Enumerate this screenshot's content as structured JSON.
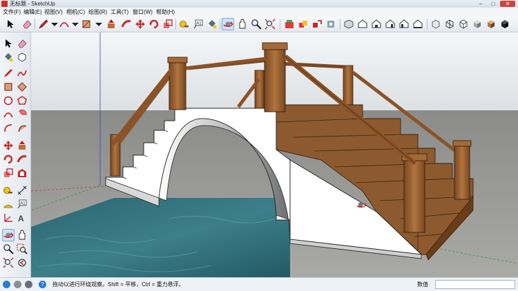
{
  "window": {
    "title": "无标题 - SketchUp",
    "controls": [
      "–",
      "□",
      "✕"
    ]
  },
  "menu": [
    "文件(F)",
    "编辑(E)",
    "视图(V)",
    "相机(C)",
    "绘图(R)",
    "工具(T)",
    "窗口(W)",
    "帮助(H)"
  ],
  "toolbar": {
    "icons": [
      "select-arrow-icon",
      "eraser-icon",
      "pencil-line-icon",
      "dropdown-arrow-icon",
      "arc-icon",
      "dropdown-arrow-icon",
      "rectangle-icon",
      "dropdown-arrow-icon",
      "push-pull-icon",
      "follow-me-icon",
      "move-icon",
      "rotate-icon",
      "tape-measure-icon",
      "text-icon",
      "paint-bucket-icon",
      "orbit-icon",
      "pan-icon",
      "zoom-icon",
      "zoom-extents-icon",
      "warehouse-icon",
      "components-icon",
      "share-icon",
      "extension-icon",
      "iso-view-icon",
      "top-view-icon",
      "front-view-icon",
      "right-view-icon",
      "back-view-icon",
      "left-view-icon",
      "xray-icon",
      "wireframe-icon",
      "hidden-line-icon",
      "shaded-icon",
      "textured-icon",
      "monochrome-icon"
    ],
    "selected": "orbit-icon"
  },
  "left_toolbar": {
    "icons": [
      "select-icon",
      "eraser-icon",
      "paint-bucket-icon",
      "make-component-icon",
      "line-icon",
      "freehand-icon",
      "rectangle-icon",
      "rotated-rectangle-icon",
      "circle-icon",
      "polygon-icon",
      "arc-icon",
      "pie-icon",
      "two-point-arc-icon",
      "three-point-arc-icon",
      "move-icon",
      "push-pull-icon",
      "rotate-icon",
      "follow-me-icon",
      "scale-icon",
      "offset-icon",
      "tape-measure-icon",
      "dimension-icon",
      "protractor-icon",
      "text-icon",
      "axes-icon",
      "3d-text-icon",
      "orbit-icon",
      "pan-icon",
      "zoom-icon",
      "zoom-window-icon",
      "zoom-extents-icon",
      "previous-view-icon"
    ],
    "selected": "orbit-icon"
  },
  "status": {
    "icons": [
      "geo-location-icon",
      "credits-icon",
      "help-icon"
    ],
    "message": "拖动以进行环绕观察。Shift = 平移，Ctrl = 重力悬浮。",
    "measurements_label": "数值",
    "measurements_value": ""
  },
  "colors": {
    "sky": "#eef1f4",
    "ground": "#9b9c98",
    "water": "#2e6a76",
    "wood": "#9b6233",
    "wood_dark": "#6e4019",
    "bridge_white": "#ffffff",
    "selected_tool": "#cfe3f7"
  }
}
